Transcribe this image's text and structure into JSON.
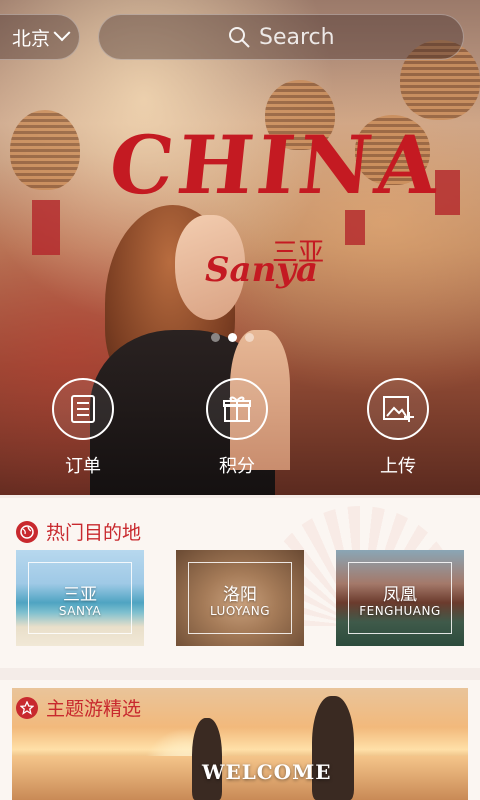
{
  "header": {
    "city": "北京",
    "search_placeholder": "Search"
  },
  "hero": {
    "title": "CHINA",
    "subtitle": "Sanya",
    "subtitle_cn": "三亚",
    "slides": 3,
    "active_slide": 1
  },
  "quick_actions": [
    {
      "label": "订单",
      "icon": "order-list-icon"
    },
    {
      "label": "积分",
      "icon": "gift-icon"
    },
    {
      "label": "上传",
      "icon": "upload-photo-icon"
    }
  ],
  "destinations": {
    "title": "热门目的地",
    "icon": "globe-icon",
    "items": [
      {
        "cn": "三亚",
        "en": "SANYA"
      },
      {
        "cn": "洛阳",
        "en": "LUOYANG"
      },
      {
        "cn": "凤凰",
        "en": "FENGHUANG"
      }
    ]
  },
  "themes": {
    "title": "主题游精选",
    "icon": "star-icon",
    "banner_text": "WELCOME"
  },
  "colors": {
    "accent": "#c8292e"
  }
}
